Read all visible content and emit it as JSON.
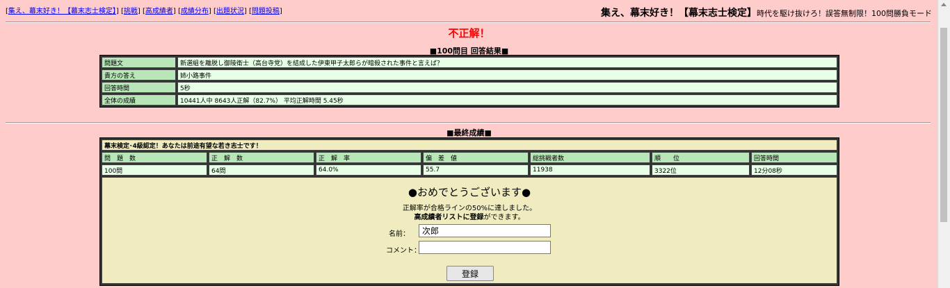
{
  "nav": {
    "items": [
      {
        "pre": "[",
        "label": "集え、幕末好き！【幕末志士検定】",
        "post": "]"
      },
      {
        "pre": " [",
        "label": "挑戦",
        "post": "]"
      },
      {
        "pre": " [",
        "label": "高成績者",
        "post": "]"
      },
      {
        "pre": " [",
        "label": "成績分布",
        "post": "]"
      },
      {
        "pre": " [",
        "label": "出題状況",
        "post": "]"
      },
      {
        "pre": " [",
        "label": "問題投稿",
        "post": "]"
      }
    ]
  },
  "brand": {
    "title": "集え、幕末好き！【幕末志士検定】",
    "subtitle": "時代を駆け抜けろ！誤答無制限！100問勝負モード"
  },
  "verdict": "不正解！",
  "answer_result": {
    "caption": "■100問目 回答結果■",
    "rows": [
      {
        "label": "問題文",
        "value": "新選組を離脱し御陵衛士（高台寺党）を結成した伊東甲子太郎らが暗殺された事件と言えば？"
      },
      {
        "label": "貴方の答え",
        "value": "姉小路事件"
      },
      {
        "label": "回答時間",
        "value": "5秒"
      },
      {
        "label": "全体の成績",
        "value": "10441人中 8643人正解（82.7%） 平均正解時間 5.45秒"
      }
    ]
  },
  "final": {
    "caption": "■最終成績■",
    "rank_message": "幕末検定･4級認定！あなたは前途有望な若き志士です！",
    "headers": [
      "問　題　数",
      "正　解　数",
      "正　解　率",
      "偏　差　値",
      "総挑戦者数",
      "順　　位",
      "回答時間"
    ],
    "values": [
      "100問",
      "64問",
      "64.0%",
      "55.7",
      "11938",
      "3322位",
      "12分08秒"
    ]
  },
  "registration": {
    "congrats": "●おめでとうございます●",
    "line1": "正解率が合格ラインの50%に達しました。",
    "line2_bold": "高成績者リストに登録",
    "line2_rest": "ができます。",
    "name_label": "名前：",
    "name_value": "次郎",
    "comment_label": "コメント：",
    "comment_value": "",
    "submit_label": "登録"
  },
  "colors": {
    "page_bg": "#ffcccc",
    "label_cell": "#b8e6b8",
    "value_cell": "#e6ffe6",
    "panel_bg": "#f0ecc0",
    "verdict": "#ff0000"
  }
}
